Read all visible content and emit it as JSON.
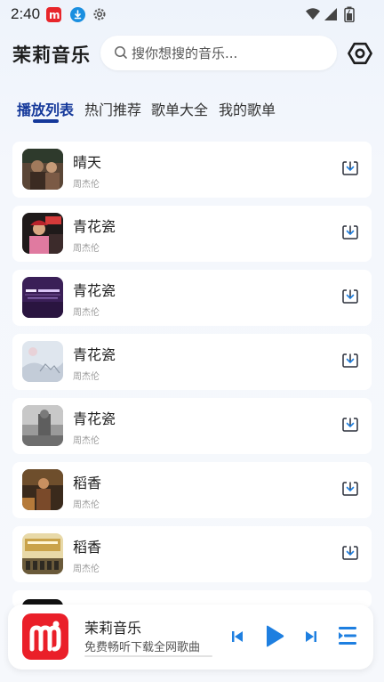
{
  "status_bar": {
    "time": "2:40"
  },
  "header": {
    "app_title": "茉莉音乐",
    "search_placeholder": "搜你想搜的音乐..."
  },
  "tabs": [
    {
      "label": "播放列表",
      "active": true
    },
    {
      "label": "热门推荐",
      "active": false
    },
    {
      "label": "歌单大全",
      "active": false
    },
    {
      "label": "我的歌单",
      "active": false
    }
  ],
  "songs": [
    {
      "title": "晴天",
      "artist": "周杰伦"
    },
    {
      "title": "青花瓷",
      "artist": "周杰伦"
    },
    {
      "title": "青花瓷",
      "artist": "周杰伦"
    },
    {
      "title": "青花瓷",
      "artist": "周杰伦"
    },
    {
      "title": "青花瓷",
      "artist": "周杰伦"
    },
    {
      "title": "稻香",
      "artist": "周杰伦"
    },
    {
      "title": "稻香",
      "artist": "周杰伦"
    }
  ],
  "player": {
    "title": "茉莉音乐",
    "subtitle": "免费畅听下载全网歌曲",
    "progress": 0
  },
  "colors": {
    "accent": "#14389a",
    "play_blue": "#1e7fe0",
    "brand_red": "#ea1f29"
  }
}
